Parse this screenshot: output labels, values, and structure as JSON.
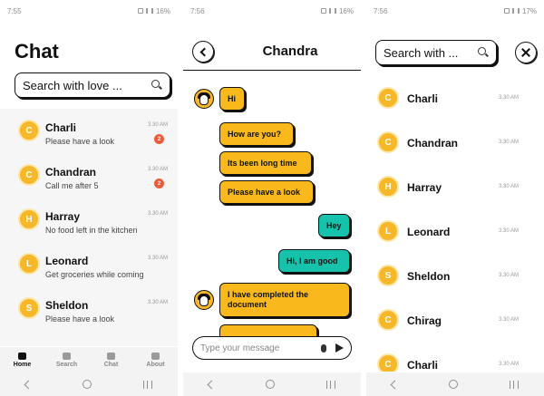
{
  "screens": {
    "home": {
      "status": {
        "time": "7:55",
        "battery": "16%"
      },
      "title": "Chat",
      "search": {
        "placeholder": "Search with love ..."
      },
      "chats": [
        {
          "initial": "C",
          "name": "Charli",
          "message": "Please have a look",
          "time": "3.30 AM",
          "badge": "2"
        },
        {
          "initial": "C",
          "name": "Chandran",
          "message": "Call me after 5",
          "time": "3.30 AM",
          "badge": "2"
        },
        {
          "initial": "H",
          "name": "Harray",
          "message": "No food left in the kitchen",
          "time": "3.30 AM",
          "badge": ""
        },
        {
          "initial": "L",
          "name": "Leonard",
          "message": "Get groceries while coming",
          "time": "3.30 AM",
          "badge": ""
        },
        {
          "initial": "S",
          "name": "Sheldon",
          "message": "Please have a look",
          "time": "3.30 AM",
          "badge": ""
        }
      ],
      "tabs": [
        {
          "label": "Home",
          "icon": "home-icon",
          "active": true
        },
        {
          "label": "Search",
          "icon": "search-icon",
          "active": false
        },
        {
          "label": "Chat",
          "icon": "chat-icon",
          "active": false
        },
        {
          "label": "About",
          "icon": "info-icon",
          "active": false
        }
      ]
    },
    "conversation": {
      "status": {
        "time": "7:56",
        "battery": "16%"
      },
      "contact_name": "Chandra",
      "messages": [
        {
          "text": "Hi",
          "direction": "incoming"
        },
        {
          "text": "How are you?",
          "direction": "incoming"
        },
        {
          "text": "Its been long time",
          "direction": "incoming"
        },
        {
          "text": "Please have a look",
          "direction": "incoming"
        },
        {
          "text": "Hey",
          "direction": "outgoing"
        },
        {
          "text": "Hi, I am good",
          "direction": "outgoing"
        },
        {
          "text": "I have completed the document",
          "direction": "incoming"
        }
      ],
      "compose": {
        "placeholder": "Type your message"
      }
    },
    "search": {
      "status": {
        "time": "7:56",
        "battery": "17%"
      },
      "search": {
        "placeholder": "Search with ..."
      },
      "results": [
        {
          "initial": "C",
          "name": "Charli",
          "time": "3.30 AM"
        },
        {
          "initial": "C",
          "name": "Chandran",
          "time": "3.30 AM"
        },
        {
          "initial": "H",
          "name": "Harray",
          "time": "3.30 AM"
        },
        {
          "initial": "L",
          "name": "Leonard",
          "time": "3.30 AM"
        },
        {
          "initial": "S",
          "name": "Sheldon",
          "time": "3.30 AM"
        },
        {
          "initial": "C",
          "name": "Chirag",
          "time": "3.30 AM"
        },
        {
          "initial": "C",
          "name": "Charli",
          "time": "3.30 AM"
        }
      ]
    }
  },
  "colors": {
    "accent_yellow": "#f9b91c",
    "accent_teal": "#17c2ad",
    "badge_red": "#ef5b3a",
    "outline": "#111111"
  }
}
